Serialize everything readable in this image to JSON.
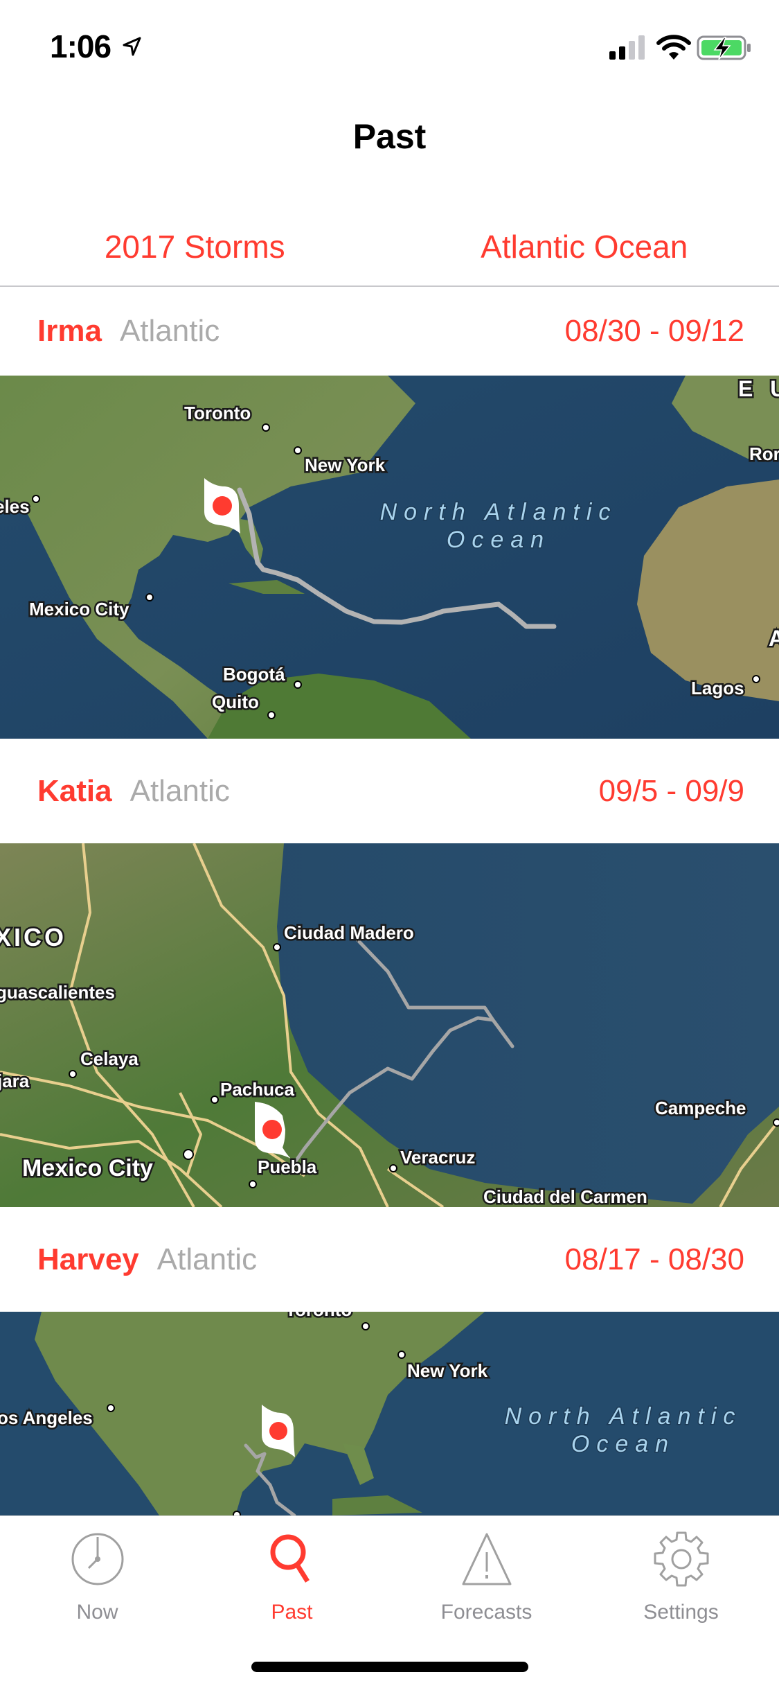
{
  "status_bar": {
    "time": "1:06",
    "icons": [
      "location-arrow-icon",
      "cellular-signal-icon",
      "wifi-icon",
      "battery-charging-icon"
    ],
    "battery_color": "#4cd964"
  },
  "header": {
    "title": "Past"
  },
  "filters": {
    "year": "2017 Storms",
    "basin": "Atlantic Ocean"
  },
  "theme": {
    "accent": "#ff3b30",
    "muted": "#aaaaaa",
    "tab_inactive": "#8e8e93"
  },
  "storms": [
    {
      "name": "Irma",
      "basin": "Atlantic",
      "dates": "08/30 - 09/12",
      "map": {
        "labels": [
          "Toronto",
          "New York",
          "eles",
          "Mexico City",
          "Bogotá",
          "Quito",
          "Lagos",
          "E U",
          "Ror",
          "A"
        ],
        "ocean_label": [
          "North Atlantic",
          "Ocean"
        ]
      }
    },
    {
      "name": "Katia",
      "basin": "Atlantic",
      "dates": "09/5 - 09/9",
      "map": {
        "labels": [
          "XICO",
          "Ciudad Madero",
          "guascalientes",
          "Celaya",
          "jara",
          "Pachuca",
          "Campeche",
          "Mexico City",
          "Puebla",
          "Veracruz",
          "Ciudad del Carmen"
        ]
      }
    },
    {
      "name": "Harvey",
      "basin": "Atlantic",
      "dates": "08/17 - 08/30",
      "map": {
        "labels": [
          "Toronto",
          "New York",
          "os Angeles"
        ],
        "ocean_label": [
          "North Atlantic",
          "Ocean"
        ]
      }
    }
  ],
  "tabs": [
    {
      "label": "Now",
      "icon": "clock-icon",
      "active": false
    },
    {
      "label": "Past",
      "icon": "magnifier-icon",
      "active": true
    },
    {
      "label": "Forecasts",
      "icon": "warning-triangle-icon",
      "active": false
    },
    {
      "label": "Settings",
      "icon": "gear-icon",
      "active": false
    }
  ]
}
